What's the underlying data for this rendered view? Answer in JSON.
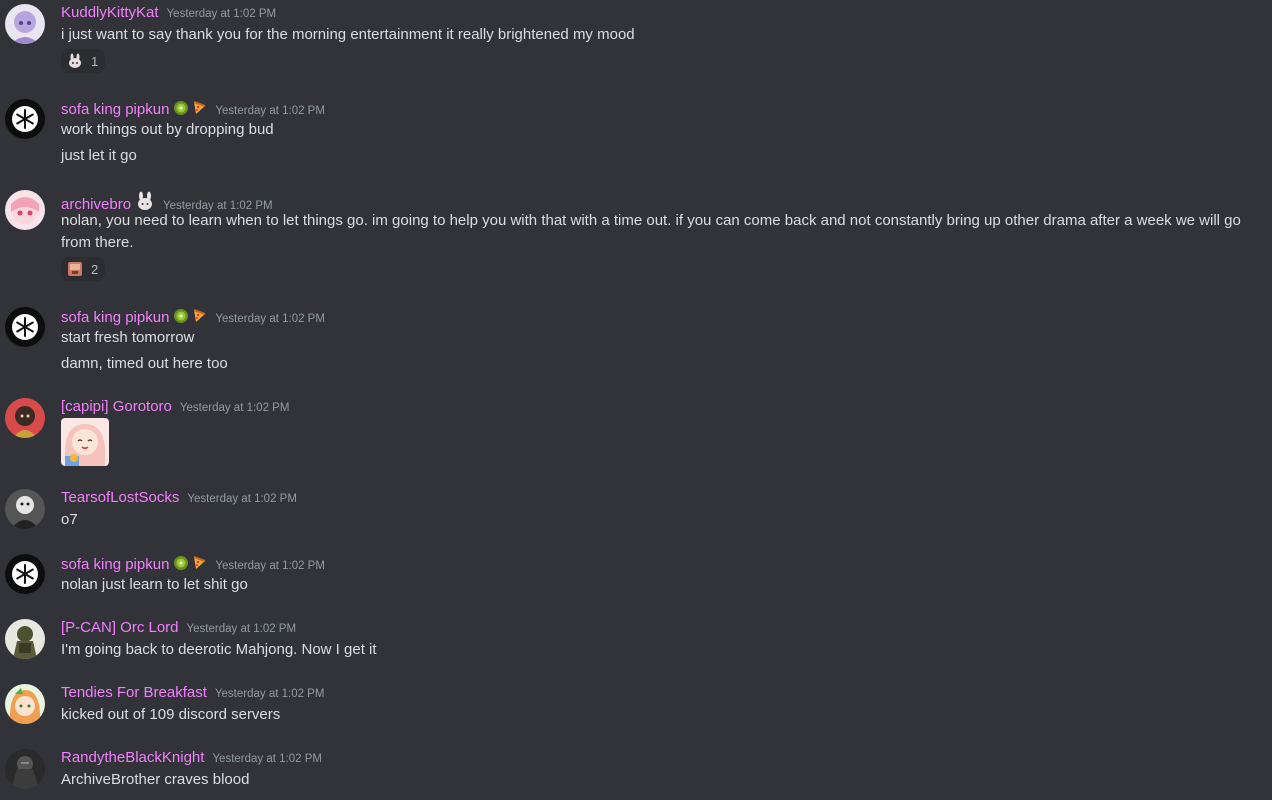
{
  "messages": [
    {
      "author": "KuddlyKittyKat",
      "timestamp": "Yesterday at 1:02 PM",
      "lines": [
        "i just want to say thank you for the morning entertainment it really brightened my mood"
      ],
      "reaction": {
        "emoji": "bunny-emoji",
        "count": "1"
      }
    },
    {
      "author": "sofa king pipkun",
      "timestamp": "Yesterday at 1:02 PM",
      "badges": [
        "kiwi-icon",
        "pizza-icon"
      ],
      "lines": [
        "work things out by dropping bud",
        "just let it go"
      ]
    },
    {
      "author": "archivebro",
      "timestamp": "Yesterday at 1:02 PM",
      "badges": [
        "bunny-badge-icon"
      ],
      "lines": [
        "nolan, you need to learn when to let things go. im going to help you with that with a time out. if you can come back and not constantly bring up other drama after a week we will go from there."
      ],
      "reaction": {
        "emoji": "face-emoji",
        "count": "2"
      }
    },
    {
      "author": "sofa king pipkun",
      "timestamp": "Yesterday at 1:02 PM",
      "badges": [
        "kiwi-icon",
        "pizza-icon"
      ],
      "lines": [
        "start fresh tomorrow",
        "damn, timed out here too"
      ]
    },
    {
      "author": "[capipi] Gorotoro",
      "timestamp": "Yesterday at 1:02 PM",
      "sticker": "anime-girl-sticker"
    },
    {
      "author": "TearsofLostSocks",
      "timestamp": "Yesterday at 1:02 PM",
      "lines": [
        "o7"
      ]
    },
    {
      "author": "sofa king pipkun",
      "timestamp": "Yesterday at 1:02 PM",
      "badges": [
        "kiwi-icon",
        "pizza-icon"
      ],
      "lines": [
        "nolan just learn to let shit go"
      ]
    },
    {
      "author": "[P-CAN] Orc Lord",
      "timestamp": "Yesterday at 1:02 PM",
      "lines": [
        "I'm going back to deerotic Mahjong. Now I get it"
      ]
    },
    {
      "author": "Tendies For Breakfast",
      "timestamp": "Yesterday at 1:02 PM",
      "lines": [
        "kicked out of 109 discord servers"
      ]
    },
    {
      "author": "RandytheBlackKnight",
      "timestamp": "Yesterday at 1:02 PM",
      "lines": [
        "ArchiveBrother craves blood"
      ]
    }
  ],
  "colors": {
    "background": "#313338",
    "username": "#f47fff",
    "text": "#dbdee1",
    "timestamp": "#949ba4"
  }
}
